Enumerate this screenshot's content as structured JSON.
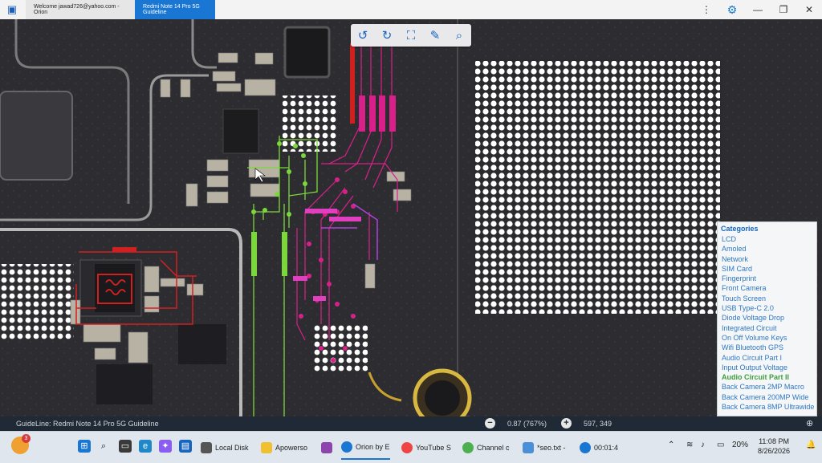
{
  "window": {
    "tabs": [
      {
        "label": "Welcome jawad726@yahoo.com - Orion"
      },
      {
        "label": "Redmi Note 14 Pro 5G Guideline"
      }
    ]
  },
  "toolbar": {
    "icons": [
      "rotate-left-icon",
      "rotate-right-icon",
      "fit-screen-icon",
      "draw-tool-icon",
      "search-icon"
    ]
  },
  "categories": {
    "title": "Categories",
    "items": [
      "LCD",
      "Amoled",
      "Network",
      "SIM Card",
      "Fingerprint",
      "Front Camera",
      "Touch Screen",
      "USB Type-C 2.0",
      "Diode Voltage Drop",
      "Integrated Circuit",
      "On Off Volume Keys",
      "Wifi Bluetooth GPS",
      "Audio Circuit Part I",
      "Input Output Voltage",
      "Audio Circuit Part II",
      "Back Camera 2MP Macro",
      "Back Camera 200MP Wide",
      "Back Camera 8MP Ultrawide"
    ],
    "active_item": "Audio Circuit Part II"
  },
  "status": {
    "guideline": "GuideLine: Redmi Note 14 Pro 5G Guideline",
    "zoom": "0.87 (767%)",
    "coordinates": "597, 349"
  },
  "taskbar": {
    "weather_badge": "3",
    "apps": [
      "Local Disk",
      "Apowerso",
      "Orion by E",
      "YouTube S",
      "Channel c",
      "*seo.txt -",
      "00:01:4"
    ],
    "battery": "20%",
    "time": "11:08 PM",
    "date": "8/26/2026"
  },
  "colors": {
    "accent": "#1976d2",
    "trace_green": "#7bd83a",
    "trace_magenta": "#e0208a",
    "trace_red": "#d02020",
    "active_category": "#3f9e3a"
  }
}
